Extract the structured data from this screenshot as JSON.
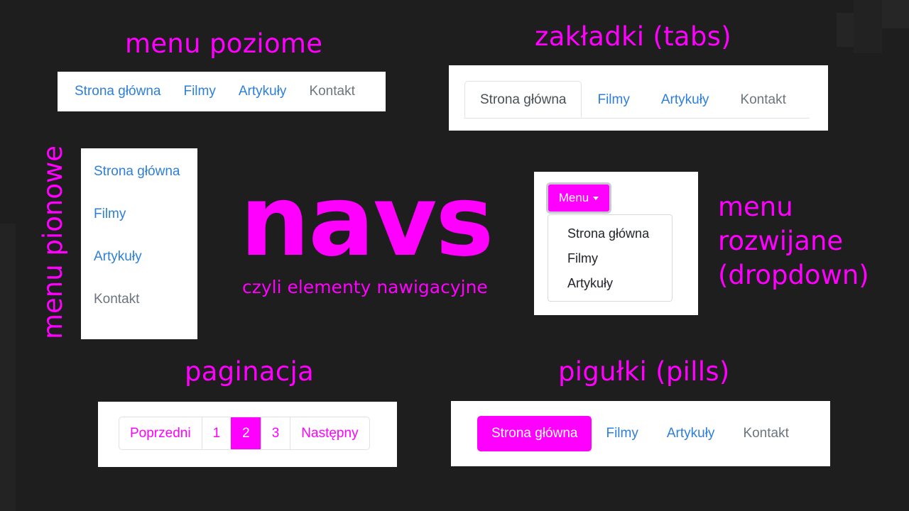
{
  "headings": {
    "horizontal": "menu poziome",
    "tabs": "zakładki (tabs)",
    "vertical": "menu pionowe",
    "dropdown_lines": [
      "menu",
      "rozwijane",
      "(dropdown)"
    ],
    "pagination": "paginacja",
    "pills": "pigułki (pills)"
  },
  "center": {
    "title": "navs",
    "subtitle": "czyli elementy nawigacyjne"
  },
  "nav_items": [
    "Strona główna",
    "Filmy",
    "Artykuły",
    "Kontakt"
  ],
  "dropdown": {
    "button_label": "Menu",
    "items": [
      "Strona główna",
      "Filmy",
      "Artykuły"
    ]
  },
  "pagination": {
    "prev": "Poprzedni",
    "pages": [
      "1",
      "2",
      "3"
    ],
    "active_page": "2",
    "next": "Następny"
  },
  "colors": {
    "accent": "#ff00ff",
    "link": "#2d7fd9",
    "disabled": "#6c757d",
    "background": "#1e1e1f"
  }
}
